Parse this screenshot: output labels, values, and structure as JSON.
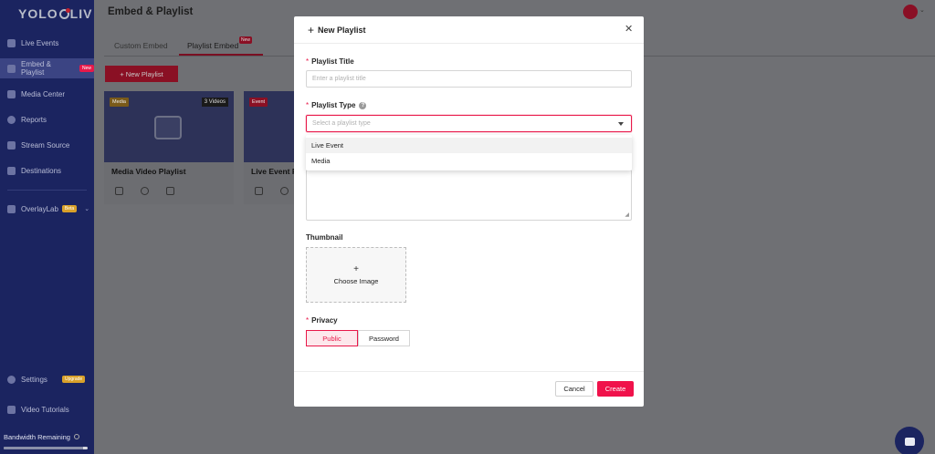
{
  "app": {
    "logo_left": "YOLO",
    "logo_right": "LIV"
  },
  "sidebar": {
    "items": [
      {
        "label": "Live Events"
      },
      {
        "label": "Embed & Playlist",
        "badge": "New"
      },
      {
        "label": "Media Center"
      },
      {
        "label": "Reports"
      },
      {
        "label": "Stream Source"
      },
      {
        "label": "Destinations"
      },
      {
        "label": "OverlayLab",
        "badge": "Beta"
      },
      {
        "label": "Settings",
        "badge": "Upgrade"
      },
      {
        "label": "Video Tutorials"
      }
    ],
    "bandwidth_label": "Bandwidth Remaining",
    "bandwidth_info_icon": "info-icon",
    "bandwidth_fraction": 0.95
  },
  "header": {
    "title": "Embed & Playlist"
  },
  "tabs": [
    {
      "label": "Custom Embed"
    },
    {
      "label": "Playlist Embed",
      "badge": "New"
    }
  ],
  "new_playlist_button": "+ New Playlist",
  "cards": [
    {
      "tag": "Media",
      "count": "3 Videos",
      "title": "Media Video Playlist",
      "tag_color": "#7a5a1a"
    },
    {
      "tag": "Event",
      "title": "Live Event P",
      "tag_color": "#8a1024"
    }
  ],
  "modal": {
    "title": "New Playlist",
    "fields": {
      "title_label": "Playlist Title",
      "title_placeholder": "Enter a playlist title",
      "type_label": "Playlist Type",
      "type_placeholder": "Select a playlist type",
      "type_options": [
        "Live Event",
        "Media"
      ],
      "thumbnail_label": "Thumbnail",
      "thumbnail_button": "Choose Image",
      "privacy_label": "Privacy",
      "privacy_options": [
        "Public",
        "Password"
      ],
      "privacy_selected": "Public"
    },
    "cancel_label": "Cancel",
    "create_label": "Create"
  },
  "colors": {
    "accent": "#f0124b",
    "sidebar_bg": "#1b2460"
  }
}
